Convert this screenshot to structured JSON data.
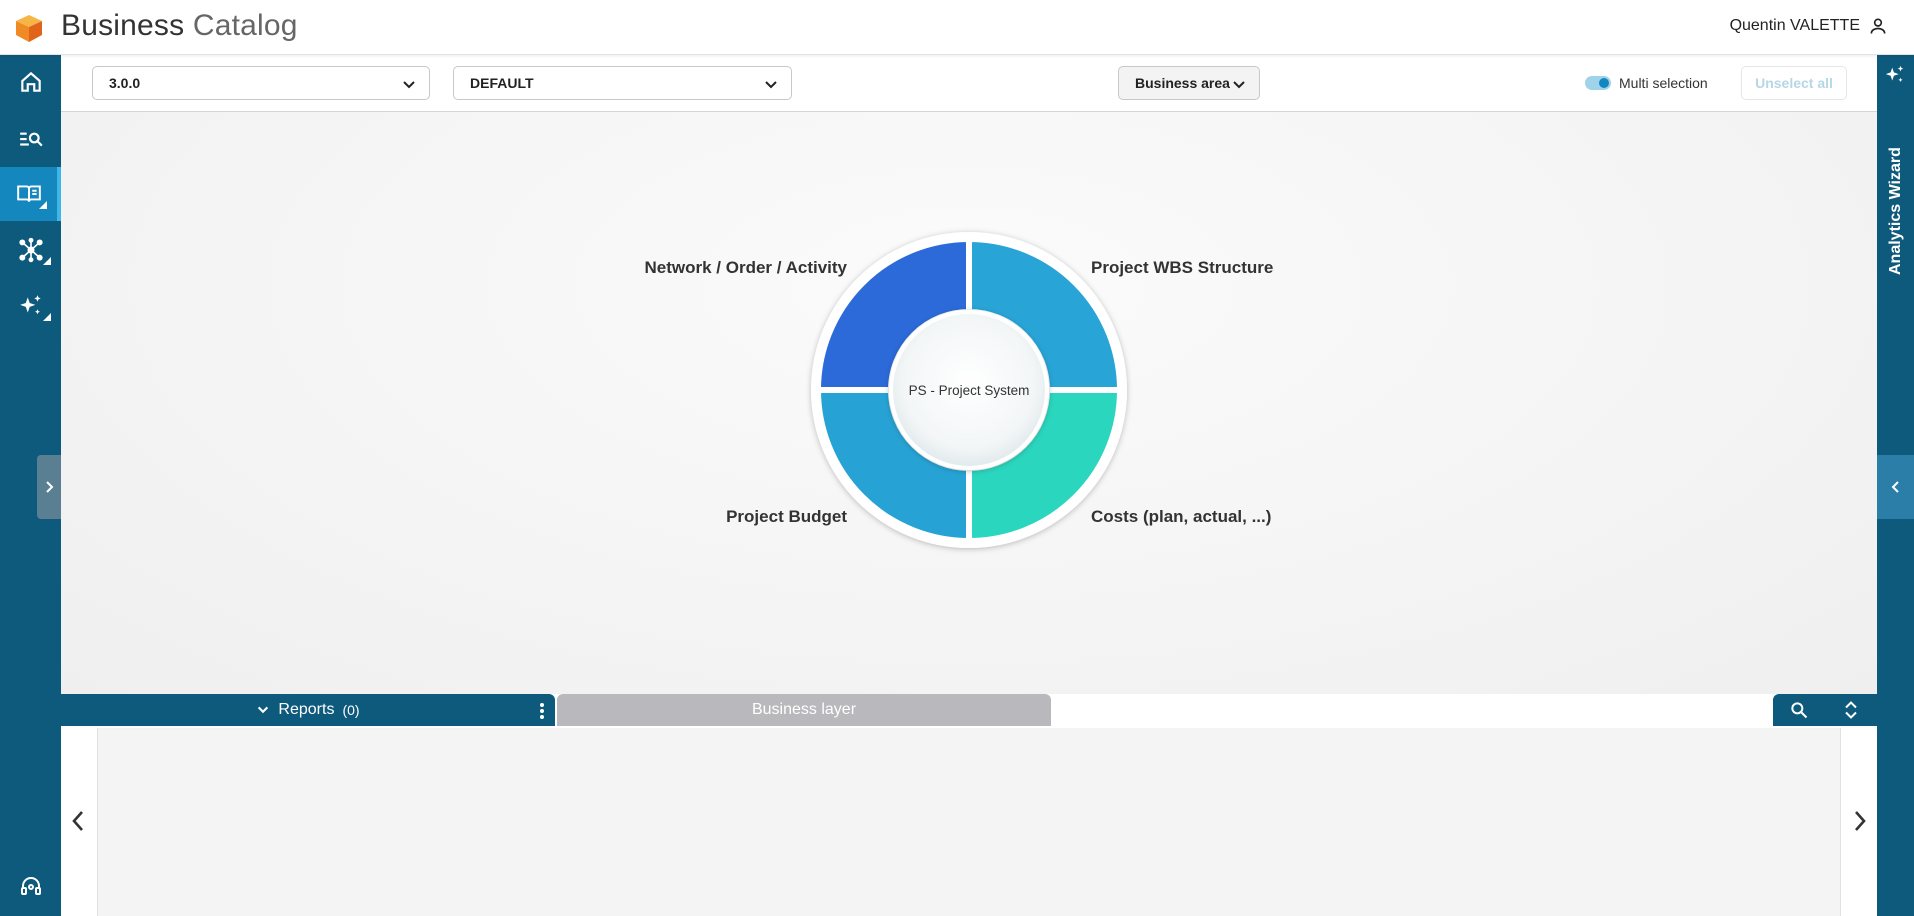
{
  "header": {
    "title_main": "Business",
    "title_light": "Catalog",
    "user_name": "Quentin VALETTE"
  },
  "sidebar": {
    "items": [
      {
        "icon": "home-icon"
      },
      {
        "icon": "search-list-icon"
      },
      {
        "icon": "book-icon",
        "active": true
      },
      {
        "icon": "network-icon"
      },
      {
        "icon": "sparkle-icon"
      }
    ],
    "bottom_icon": "support-icon"
  },
  "toolbar": {
    "version_value": "3.0.0",
    "context_value": "DEFAULT",
    "area_value": "Business area",
    "multi_selection_label": "Multi selection",
    "unselect_label": "Unselect all"
  },
  "right_panel": {
    "wizard_label": "Analytics Wizard"
  },
  "chart": {
    "center_label": "PS - Project System",
    "segments": [
      {
        "label": "Network / Order / Activity",
        "color": "#2b6ad8",
        "value": 25
      },
      {
        "label": "Project WBS Structure",
        "color": "#28a4d6",
        "value": 25
      },
      {
        "label": "Costs (plan, actual, ...)",
        "color": "#2bd6be",
        "value": 25
      },
      {
        "label": "Project Budget",
        "color": "#26a3d4",
        "value": 25
      }
    ]
  },
  "bottom": {
    "reports_label": "Reports",
    "reports_count": "(0)",
    "business_layer_label": "Business layer"
  },
  "colors": {
    "sidebar": "#0e5a7d",
    "active": "#1487bf"
  }
}
